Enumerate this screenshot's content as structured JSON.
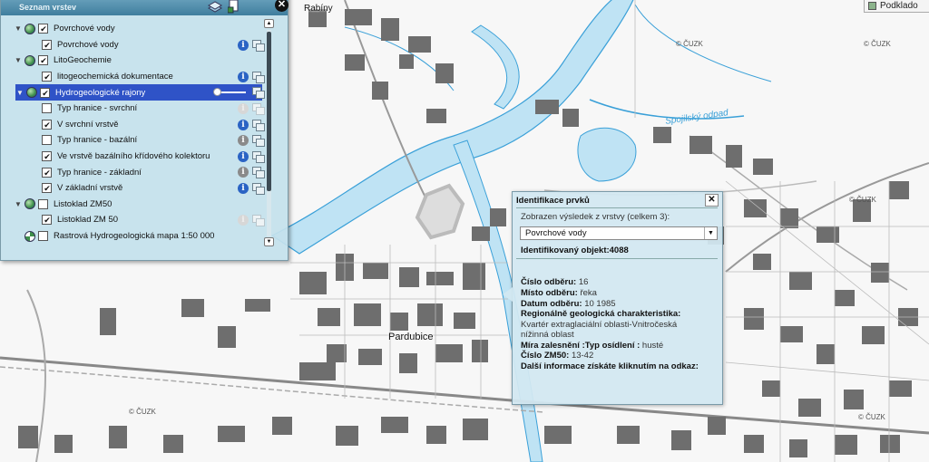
{
  "map": {
    "copyright": "© ČUZK",
    "city": "Pardubice",
    "district_partial": "Rabíny",
    "river_label": "Spojilský odpad"
  },
  "basemap_button": {
    "label": "Podklado"
  },
  "layer_panel": {
    "title": "Seznam vrstev",
    "close_label": "✕",
    "rows": [
      {
        "label": "Povrchové vody",
        "kind": "group",
        "checked": true
      },
      {
        "label": "Povrchové vody",
        "kind": "layer",
        "checked": true,
        "info": "blue",
        "legend": true
      },
      {
        "label": "LitoGeochemie",
        "kind": "group",
        "checked": true
      },
      {
        "label": "litogeochemická dokumentace",
        "kind": "layer",
        "checked": true,
        "info": "blue",
        "legend": true
      },
      {
        "label": "Hydrogeologické rajony",
        "kind": "group",
        "checked": true,
        "selected": true
      },
      {
        "label": "Typ hranice - svrchní",
        "kind": "layer",
        "checked": false,
        "info": "dim",
        "legend": true
      },
      {
        "label": "V svrchní vrstvě",
        "kind": "layer",
        "checked": true,
        "info": "blue",
        "legend": true
      },
      {
        "label": "Typ hranice - bazální",
        "kind": "layer",
        "checked": false,
        "info": "grey",
        "legend": true
      },
      {
        "label": "Ve vrstvě bazálního křídového kolektoru",
        "kind": "layer",
        "checked": true,
        "info": "blue",
        "legend": true
      },
      {
        "label": "Typ hranice - základní",
        "kind": "layer",
        "checked": true,
        "info": "grey",
        "legend": true
      },
      {
        "label": "V základní vrstvě",
        "kind": "layer",
        "checked": true,
        "info": "blue",
        "legend": true
      },
      {
        "label": "Listoklad ZM50",
        "kind": "group",
        "checked": false
      },
      {
        "label": "Listoklad ZM 50",
        "kind": "layer",
        "checked": true,
        "info": "dim",
        "legend": true
      },
      {
        "label": "Rastrová Hydrogeologická mapa 1:50 000",
        "kind": "raster",
        "checked": false
      }
    ]
  },
  "identify": {
    "title": "Identifikace prvků",
    "close_label": "✕",
    "subtitle": "Zobrazen výsledek z vrstvy (celkem 3):",
    "selected_layer": "Povrchové vody",
    "object_id": "Identifikovaný objekt:4088",
    "lines": [
      {
        "key": "Číslo odběru:",
        "value": " 16"
      },
      {
        "key": "Místo odběru:",
        "value": " řeka"
      },
      {
        "key": "Datum odběru:",
        "value": " 10  1985"
      },
      {
        "key": "Regionálně geologická charakteristika:",
        "value": ""
      },
      {
        "key": "",
        "value": "Kvartér extraglaciální oblasti-Vnitročeská"
      },
      {
        "key": "",
        "value": "nížinná oblast"
      },
      {
        "key": "Míra zalesnění :Typ osídlení :",
        "value": " husté"
      },
      {
        "key": "Číslo ZM50:",
        "value": " 13-42"
      },
      {
        "key": "Další informace získáte kliknutím na odkaz:",
        "value": ""
      }
    ]
  }
}
